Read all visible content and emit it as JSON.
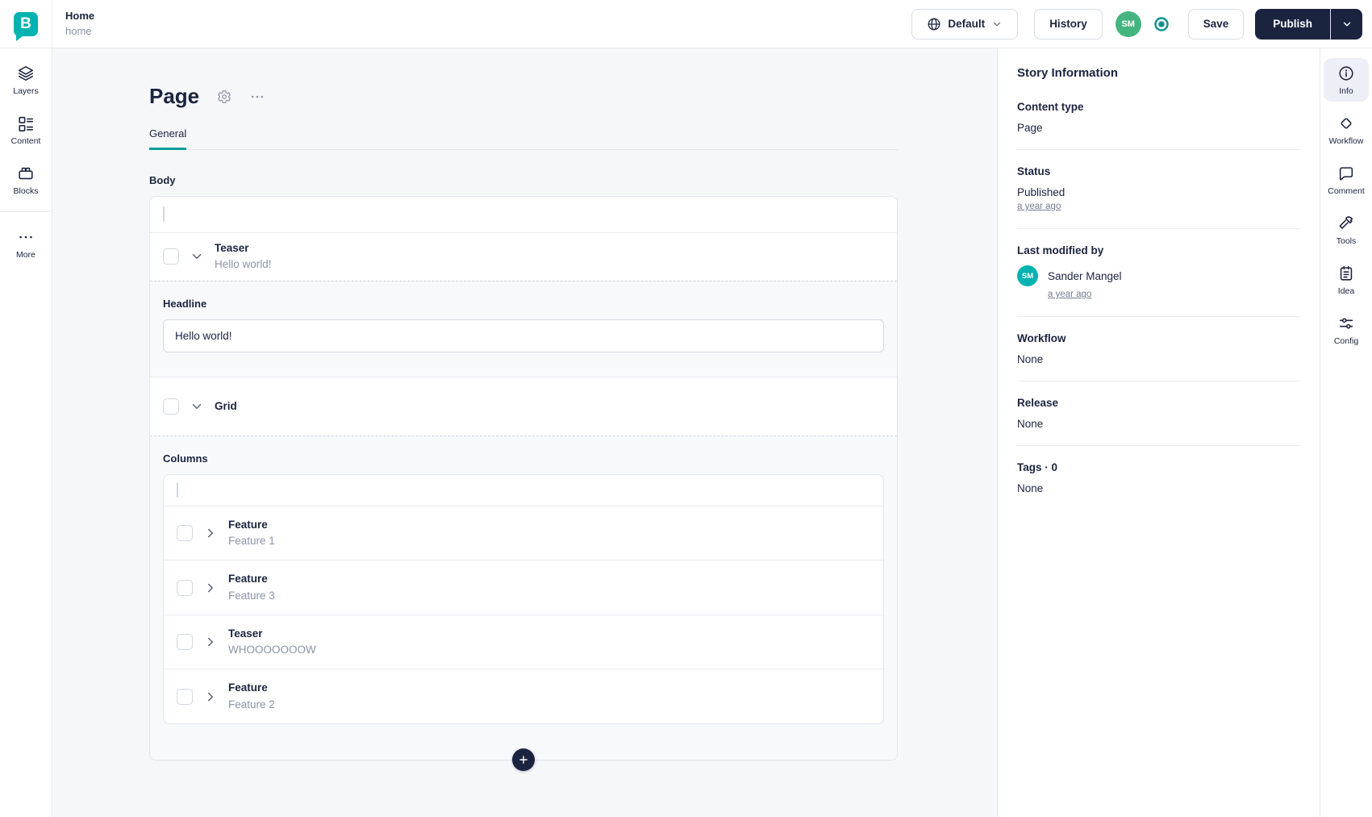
{
  "topbar": {
    "breadcrumb_title": "Home",
    "breadcrumb_slug": "home",
    "language_label": "Default",
    "history_label": "History",
    "avatar_initials": "SM",
    "save_label": "Save",
    "publish_label": "Publish"
  },
  "left_sidebar": {
    "items": [
      {
        "label": "Layers"
      },
      {
        "label": "Content"
      },
      {
        "label": "Blocks"
      },
      {
        "label": "More"
      }
    ]
  },
  "editor": {
    "title": "Page",
    "tab_general": "General",
    "body_label": "Body",
    "teaser_block": {
      "title": "Teaser",
      "subtitle": "Hello world!"
    },
    "headline_label": "Headline",
    "headline_value": "Hello world!",
    "grid_block": {
      "title": "Grid"
    },
    "columns_label": "Columns",
    "columns": [
      {
        "title": "Feature",
        "subtitle": "Feature 1"
      },
      {
        "title": "Feature",
        "subtitle": "Feature 3"
      },
      {
        "title": "Teaser",
        "subtitle": "WHOOOOOOOW"
      },
      {
        "title": "Feature",
        "subtitle": "Feature 2"
      }
    ]
  },
  "story_panel": {
    "title": "Story Information",
    "content_type_label": "Content type",
    "content_type_value": "Page",
    "status_label": "Status",
    "status_value": "Published",
    "status_time": "a year ago",
    "modified_label": "Last modified by",
    "modified_avatar": "SM",
    "modified_user": "Sander Mangel",
    "modified_time": "a year ago",
    "workflow_label": "Workflow",
    "workflow_value": "None",
    "release_label": "Release",
    "release_value": "None",
    "tags_label": "Tags · 0",
    "tags_value": "None"
  },
  "right_sidebar": {
    "items": [
      {
        "label": "Info"
      },
      {
        "label": "Workflow"
      },
      {
        "label": "Comment"
      },
      {
        "label": "Tools"
      },
      {
        "label": "Idea"
      },
      {
        "label": "Config"
      }
    ]
  },
  "colors": {
    "brand_teal": "#00b3b0",
    "ink_navy": "#1b243f",
    "avatar_green": "#44b57f"
  }
}
